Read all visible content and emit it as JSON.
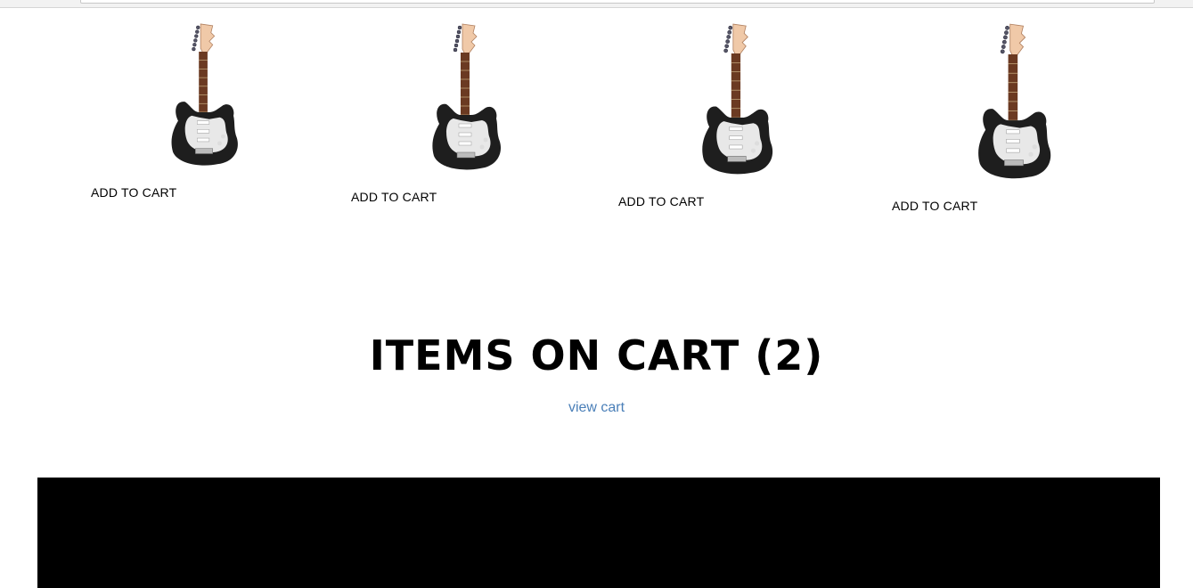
{
  "products": [
    {
      "image_name": "electric-guitar-image",
      "add_to_cart_label": "ADD TO CART"
    },
    {
      "image_name": "electric-guitar-image",
      "add_to_cart_label": "ADD TO CART"
    },
    {
      "image_name": "electric-guitar-image",
      "add_to_cart_label": "ADD TO CART"
    },
    {
      "image_name": "electric-guitar-image",
      "add_to_cart_label": "ADD TO CART"
    }
  ],
  "cart": {
    "title": "ITEMS ON CART (2)",
    "view_cart_link": "view cart"
  },
  "colors": {
    "link": "#4a7fb8",
    "footer": "#000000",
    "guitar_body": "#1e1e1e",
    "pickguard": "#e8e8e8",
    "neck": "#6b3a22",
    "headstock": "#f0c9a8"
  }
}
